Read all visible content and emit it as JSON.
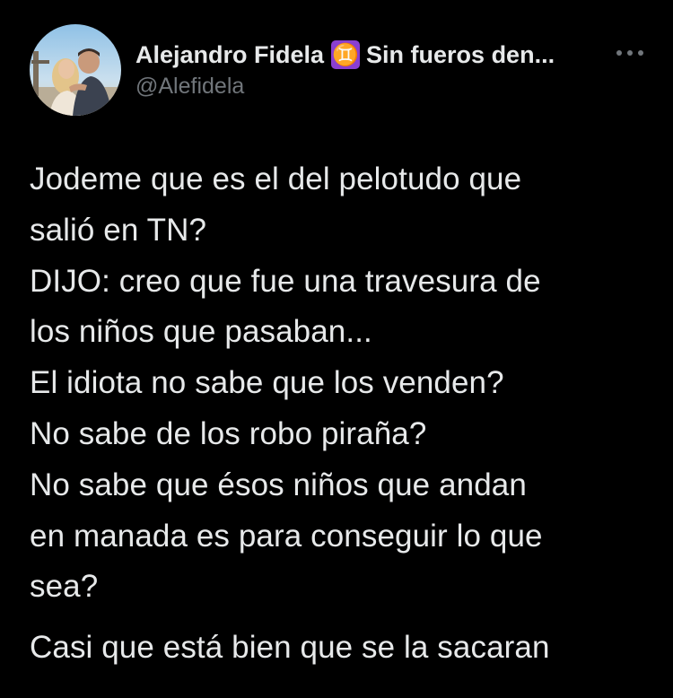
{
  "tweet": {
    "author": {
      "display_name": "Alejandro Fidela",
      "zodiac_badge": "♊",
      "display_suffix": "Sin fueros den...",
      "handle": "@Alefidela",
      "avatar_icon": "avatar-photo"
    },
    "more_icon": "more-options-icon",
    "text_lines": [
      "Jodeme que es el del pelotudo que",
      "salió en TN?",
      "DIJO: creo que fue una travesura de",
      "los niños que pasaban...",
      "El idiota no sabe que los venden?",
      "No sabe de los robo piraña?",
      "No sabe que ésos niños que andan",
      "en manada es para conseguir lo que",
      "sea?"
    ],
    "last_paragraph": "Casi que está bien que se la sacaran"
  },
  "colors": {
    "background": "#000000",
    "text_primary": "#e7e9ea",
    "text_secondary": "#71767b",
    "badge_purple": "#8a3fd1"
  }
}
